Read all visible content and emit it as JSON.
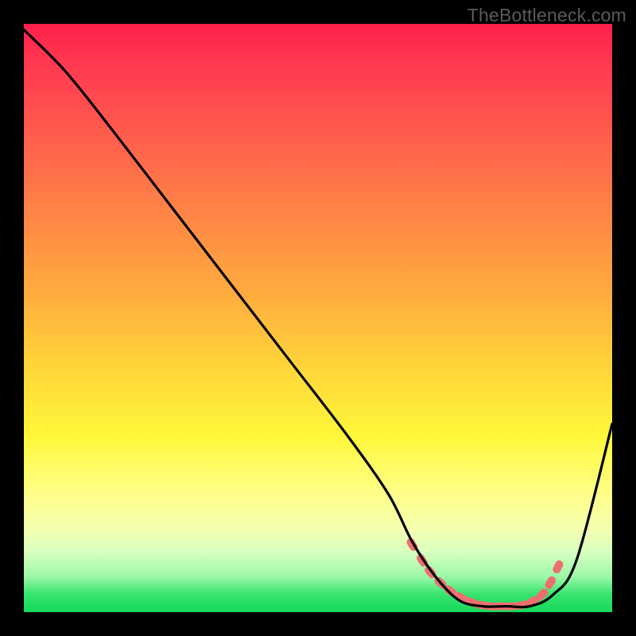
{
  "watermark": "TheBottleneck.com",
  "chart_data": {
    "type": "line",
    "title": "",
    "xlabel": "",
    "ylabel": "",
    "xlim": [
      0,
      100
    ],
    "ylim": [
      0,
      100
    ],
    "grid": false,
    "background_gradient": [
      "#ff1f4b",
      "#ff8446",
      "#ffd43a",
      "#fff73a",
      "#36e46e"
    ],
    "series": [
      {
        "name": "bottleneck-curve",
        "color": "#000000",
        "x": [
          0,
          7,
          15,
          25,
          35,
          45,
          55,
          62,
          66,
          70,
          74,
          78,
          82,
          86,
          90,
          94,
          100
        ],
        "values": [
          99,
          92,
          82,
          69,
          56,
          43,
          30,
          20,
          12,
          6,
          2,
          1,
          1,
          1,
          3,
          9,
          32
        ]
      }
    ],
    "markers": {
      "name": "bottleneck-band",
      "color": "#ef6f70",
      "shape": "pill",
      "x": [
        66.0,
        67.7,
        69.1,
        70.8,
        72.5,
        74.3,
        76.0,
        77.8,
        79.5,
        81.2,
        82.9,
        84.7,
        86.4,
        88.1,
        89.5,
        90.8
      ],
      "y": [
        11.5,
        8.8,
        6.8,
        5.0,
        3.6,
        2.5,
        1.7,
        1.2,
        1.0,
        1.0,
        1.0,
        1.2,
        1.8,
        3.0,
        5.0,
        7.7
      ]
    }
  }
}
